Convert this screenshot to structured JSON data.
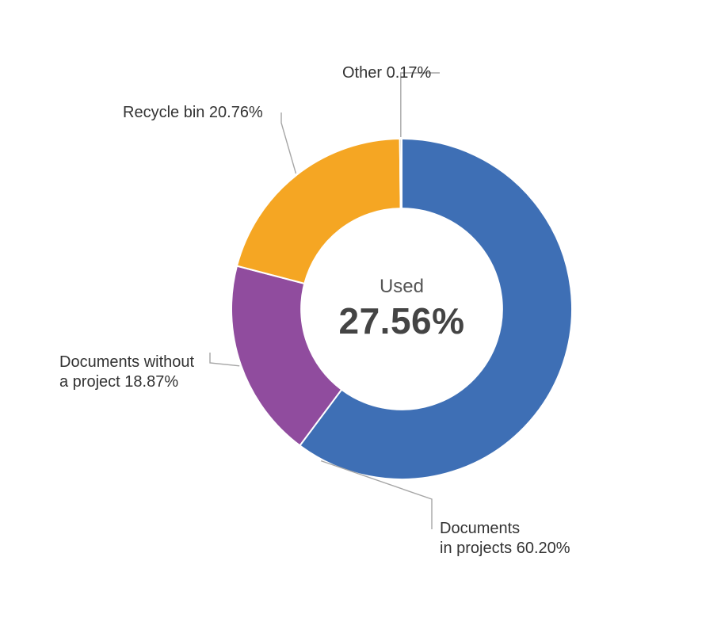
{
  "chart_data": {
    "type": "pie",
    "donut": true,
    "inner_radius_pct": 59,
    "series": [
      {
        "name": "Documents in projects",
        "value": 60.2,
        "label": "Documents\nin projects 60.20%",
        "color": "#3e6fb5"
      },
      {
        "name": "Documents without a project",
        "value": 18.87,
        "label": "Documents without\na project 18.87%",
        "color": "#904c9e"
      },
      {
        "name": "Recycle bin",
        "value": 20.76,
        "label": "Recycle bin 20.76%",
        "color": "#f5a623"
      },
      {
        "name": "Other",
        "value": 0.17,
        "label": "Other 0.17%",
        "color": "#a6a6a6"
      }
    ],
    "center": {
      "label": "Used",
      "value": "27.56%"
    }
  },
  "labels": {
    "other": "Other 0.17%",
    "recycle": "Recycle bin 20.76%",
    "without_l1": "Documents without",
    "without_l2": "a project 18.87%",
    "inproj_l1": "Documents",
    "inproj_l2": "in projects 60.20%",
    "center_used": "Used",
    "center_pct": "27.56%"
  }
}
